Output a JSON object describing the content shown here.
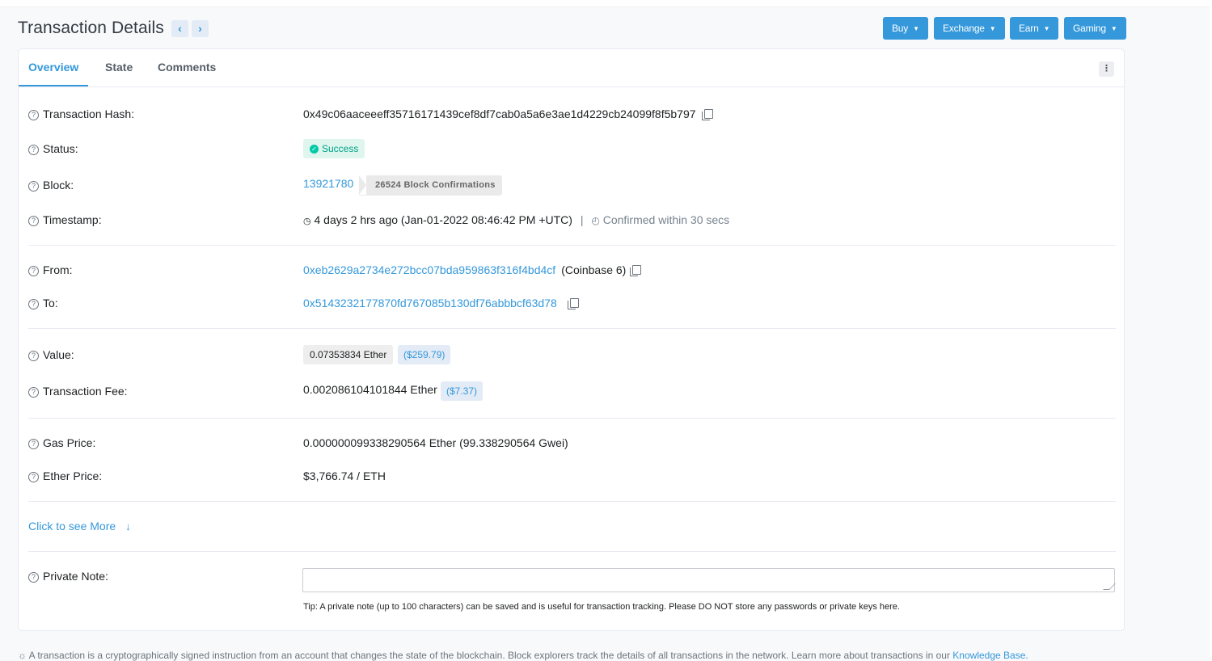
{
  "page": {
    "title": "Transaction Details"
  },
  "nav": {
    "prev": "‹",
    "next": "›"
  },
  "header_menu": [
    {
      "label": "Buy"
    },
    {
      "label": "Exchange"
    },
    {
      "label": "Earn"
    },
    {
      "label": "Gaming"
    }
  ],
  "tabs": [
    {
      "label": "Overview",
      "active": true
    },
    {
      "label": "State"
    },
    {
      "label": "Comments"
    }
  ],
  "rows": {
    "hash": {
      "label": "Transaction Hash:",
      "value": "0x49c06aaceeeff35716171439cef8df7cab0a5a6e3ae1d4229cb24099f8f5b797"
    },
    "status": {
      "label": "Status:",
      "value": "Success"
    },
    "block": {
      "label": "Block:",
      "number": "13921780",
      "confirmations": "26524 Block Confirmations"
    },
    "timestamp": {
      "label": "Timestamp:",
      "value": "4 days 2 hrs ago (Jan-01-2022 08:46:42 PM +UTC)",
      "divider": "|",
      "confirmed": "Confirmed within 30 secs"
    },
    "from": {
      "label": "From:",
      "address": "0xeb2629a2734e272bcc07bda959863f316f4bd4cf",
      "name": "(Coinbase 6)"
    },
    "to": {
      "label": "To:",
      "address": "0x5143232177870fd767085b130df76abbbcf63d78"
    },
    "value": {
      "label": "Value:",
      "ether": "0.07353834 Ether",
      "usd": "($259.79)"
    },
    "fee": {
      "label": "Transaction Fee:",
      "ether": "0.002086104101844 Ether",
      "usd": "($7.37)"
    },
    "gas_price": {
      "label": "Gas Price:",
      "value": "0.000000099338290564 Ether (99.338290564 Gwei)"
    },
    "ether_price": {
      "label": "Ether Price:",
      "value": "$3,766.74 / ETH"
    },
    "more": {
      "label": "Click to see More"
    },
    "note": {
      "label": "Private Note:",
      "placeholder": "",
      "tip": "Tip: A private note (up to 100 characters) can be saved and is useful for transaction tracking. Please DO NOT store any passwords or private keys here."
    }
  },
  "footer": {
    "text": "A transaction is a cryptographically signed instruction from an account that changes the state of the blockchain. Block explorers track the details of all transactions in the network. Learn more about transactions in our",
    "link": "Knowledge Base."
  },
  "colors": {
    "accent": "#3498db",
    "success": "#00c9a7",
    "text": "#1e2022"
  }
}
